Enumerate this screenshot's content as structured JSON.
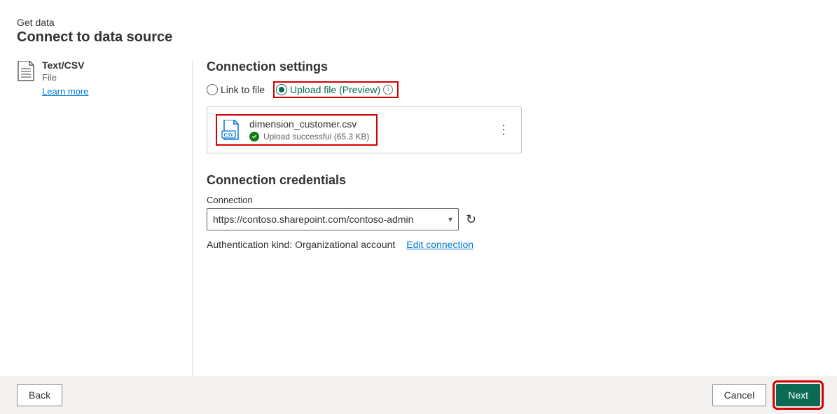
{
  "header": {
    "breadcrumb": "Get data",
    "title": "Connect to data source"
  },
  "sidebar": {
    "connector_title": "Text/CSV",
    "connector_subtitle": "File",
    "learn_more": "Learn more"
  },
  "settings": {
    "section_title": "Connection settings",
    "radio_link_label": "Link to file",
    "radio_upload_label": "Upload file (Preview)",
    "file": {
      "name": "dimension_customer.csv",
      "status": "Upload successful (65.3 KB)"
    }
  },
  "credentials": {
    "section_title": "Connection credentials",
    "connection_label": "Connection",
    "connection_value": "https://contoso.sharepoint.com/contoso-admin",
    "auth_kind_label": "Authentication kind: Organizational account",
    "edit_link": "Edit connection"
  },
  "footer": {
    "back": "Back",
    "cancel": "Cancel",
    "next": "Next"
  }
}
